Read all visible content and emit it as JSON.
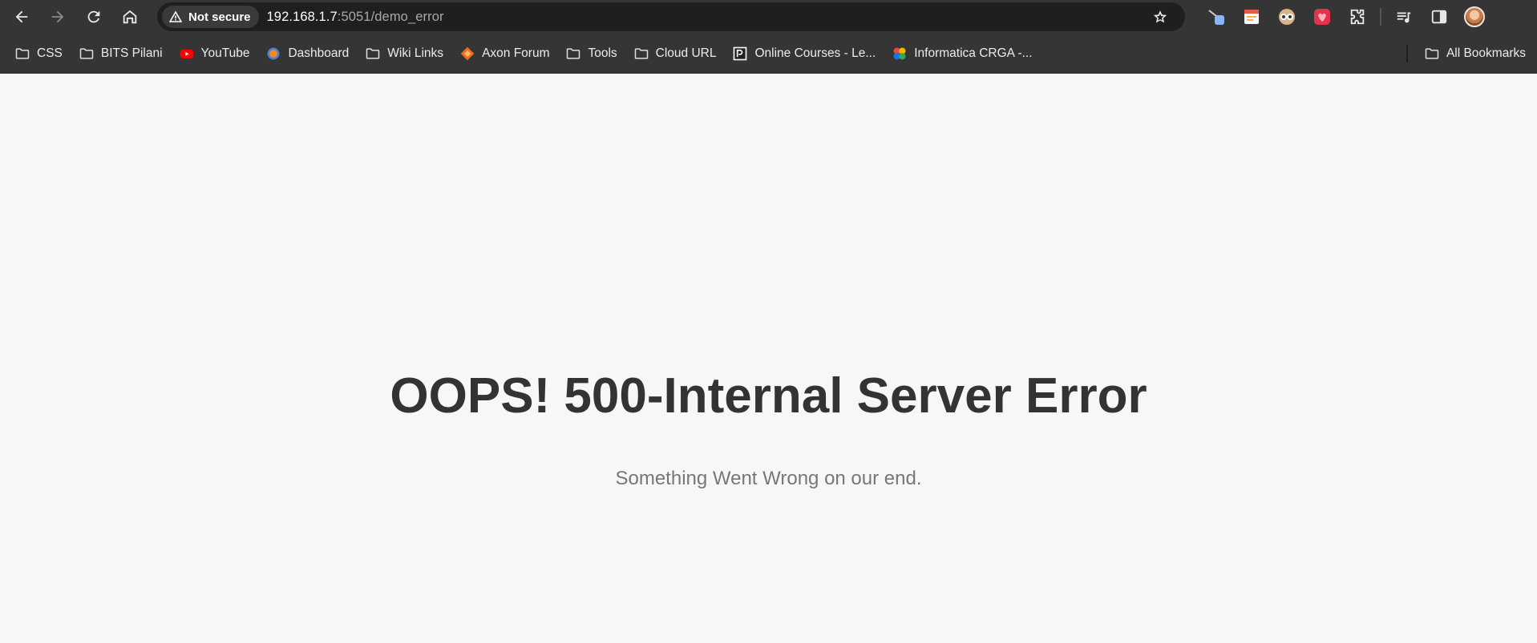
{
  "browser": {
    "security_label": "Not secure",
    "url_host": "192.168.1.7",
    "url_rest": ":5051/demo_error",
    "nav_icons": [
      "back-icon",
      "forward-icon",
      "reload-icon",
      "home-icon"
    ],
    "extension_icons": [
      "pen-extension-icon",
      "calendar-extension-icon",
      "owl-extension-icon",
      "red-extension-icon",
      "extensions-puzzle-icon",
      "media-control-icon",
      "side-panel-icon"
    ]
  },
  "bookmarks": {
    "items": [
      {
        "label": "CSS",
        "icon": "folder-icon"
      },
      {
        "label": "BITS Pilani",
        "icon": "folder-icon"
      },
      {
        "label": "YouTube",
        "icon": "youtube-icon"
      },
      {
        "label": "Dashboard",
        "icon": "dashboard-icon"
      },
      {
        "label": "Wiki Links",
        "icon": "folder-icon"
      },
      {
        "label": "Axon Forum",
        "icon": "axon-icon"
      },
      {
        "label": "Tools",
        "icon": "folder-icon"
      },
      {
        "label": "Cloud URL",
        "icon": "folder-icon"
      },
      {
        "label": "Online Courses - Le...",
        "icon": "courses-icon"
      },
      {
        "label": "Informatica CRGA -...",
        "icon": "informatica-icon"
      }
    ],
    "all_bookmarks_label": "All Bookmarks"
  },
  "page": {
    "title": "OOPS! 500-Internal Server Error",
    "subtitle": "Something Went Wrong on our end."
  },
  "colors": {
    "toolbar_bg": "#353535",
    "omnibox_bg": "#1f1f1f",
    "page_bg": "#f7f7f7",
    "title_color": "#333333",
    "subtitle_color": "#777777"
  }
}
